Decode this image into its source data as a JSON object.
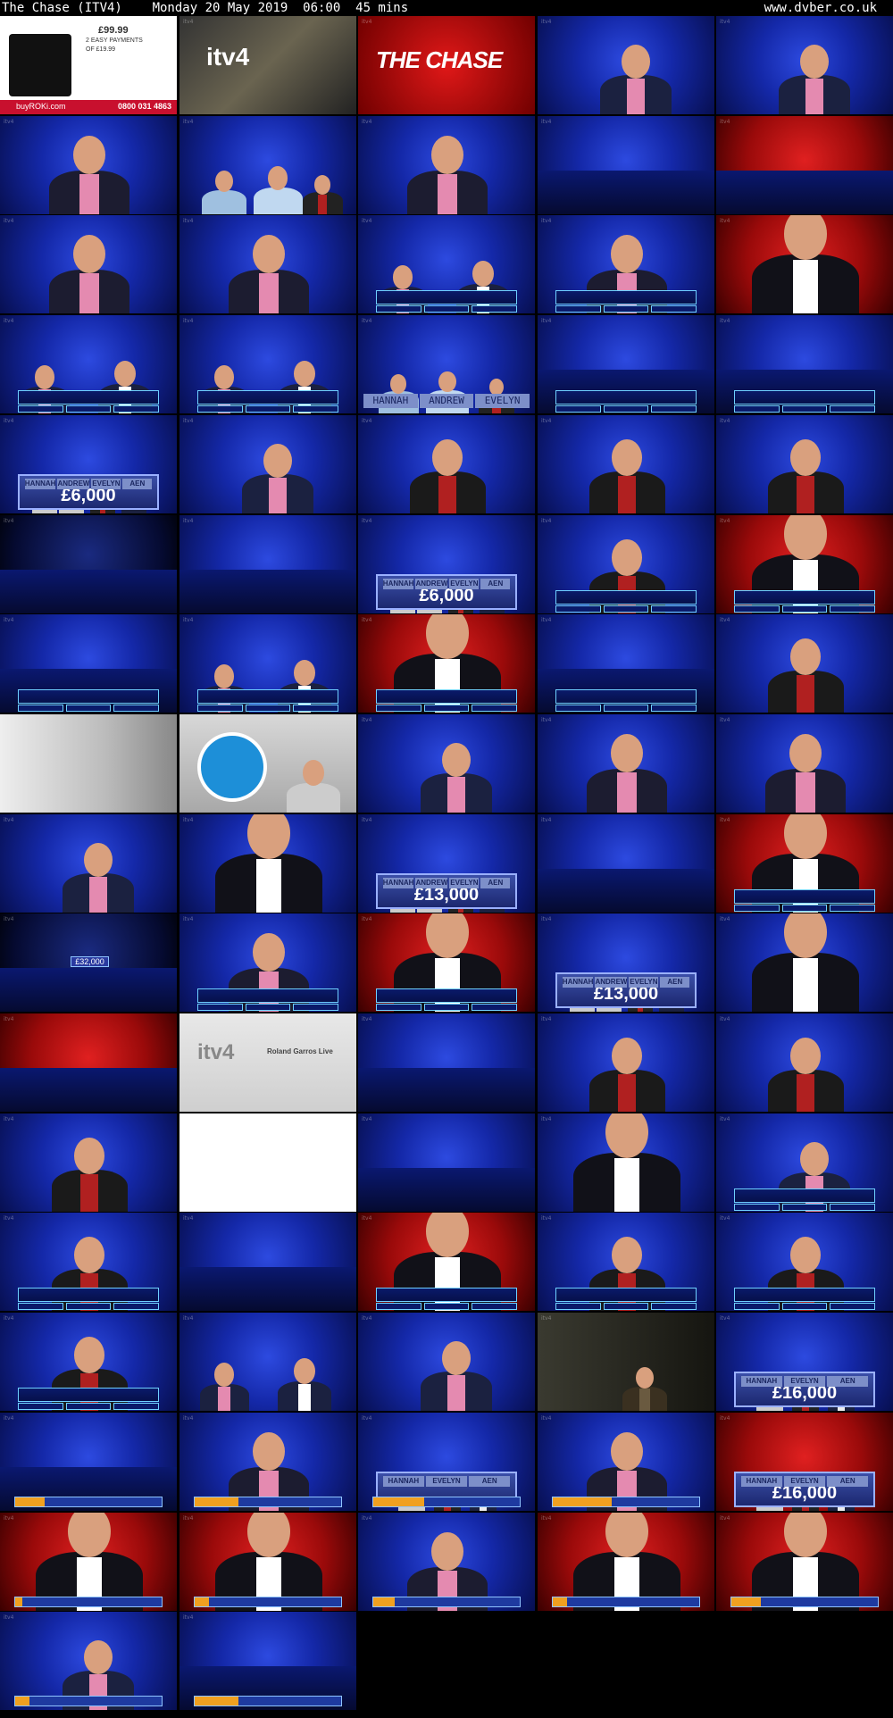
{
  "header": {
    "title": "The Chase (ITV4)    Monday 20 May 2019  06:00  45 mins",
    "site": "www.dvber.co.uk"
  },
  "colors": {
    "studio_blue": "#1a2fb0",
    "studio_red": "#c01010",
    "question_border": "#6fd0ff",
    "background": "#000000"
  },
  "ad": {
    "price": "£99.99",
    "payments": "2 EASY PAYMENTS",
    "payment_amount": "OF £19.99",
    "brand": "buyROKi.com",
    "phone": "0800 031 4863"
  },
  "idents": {
    "channel": "itv4",
    "show": "THE CHASE",
    "promo": "Roland Garros Live"
  },
  "contestants": [
    "HANNAH",
    "ANDREW",
    "EVELYN",
    "AEN"
  ],
  "contestants_late": [
    "HANNAH",
    "EVELYN",
    "AEN"
  ],
  "amounts": {
    "a6000": "£6,000",
    "a13000": "£13,000",
    "a16000": "£16,000",
    "a32000": "£32,000"
  },
  "thumbs": [
    {
      "t": "ad"
    },
    {
      "t": "itv4"
    },
    {
      "t": "chase"
    },
    {
      "t": "host",
      "bg": "blue"
    },
    {
      "t": "host",
      "bg": "blue"
    },
    {
      "t": "person",
      "bg": "blue"
    },
    {
      "t": "trio",
      "bg": "blue"
    },
    {
      "t": "person",
      "bg": "blue"
    },
    {
      "t": "set",
      "bg": "blue"
    },
    {
      "t": "set",
      "bg": "red"
    },
    {
      "t": "person",
      "bg": "blue"
    },
    {
      "t": "person",
      "bg": "blue"
    },
    {
      "t": "duo",
      "bg": "blue",
      "q": true
    },
    {
      "t": "person",
      "bg": "blue",
      "q": true
    },
    {
      "t": "chaser",
      "bg": "red"
    },
    {
      "t": "duo",
      "bg": "blue",
      "q": true
    },
    {
      "t": "duo",
      "bg": "blue",
      "q": true
    },
    {
      "t": "names",
      "bg": "blue"
    },
    {
      "t": "set",
      "bg": "blue",
      "q": true
    },
    {
      "t": "set",
      "bg": "blue",
      "q": true
    },
    {
      "t": "podium",
      "bg": "blue",
      "amt": "a6000"
    },
    {
      "t": "host",
      "bg": "blue"
    },
    {
      "t": "woman",
      "bg": "blue"
    },
    {
      "t": "woman",
      "bg": "blue"
    },
    {
      "t": "woman",
      "bg": "blue"
    },
    {
      "t": "set",
      "bg": "dark"
    },
    {
      "t": "set",
      "bg": "blue"
    },
    {
      "t": "podium",
      "bg": "blue",
      "amt": "a6000"
    },
    {
      "t": "woman",
      "bg": "blue",
      "q": true
    },
    {
      "t": "chaser",
      "bg": "red",
      "q": true
    },
    {
      "t": "set",
      "bg": "blue",
      "q": true
    },
    {
      "t": "duo",
      "bg": "blue",
      "q": true
    },
    {
      "t": "chaser",
      "bg": "red",
      "q": true
    },
    {
      "t": "set",
      "bg": "blue",
      "q": true
    },
    {
      "t": "woman",
      "bg": "blue"
    },
    {
      "t": "wall",
      "bg": "grey"
    },
    {
      "t": "trustatrader",
      "bg": "grey"
    },
    {
      "t": "host",
      "bg": "blue"
    },
    {
      "t": "person",
      "bg": "blue"
    },
    {
      "t": "person",
      "bg": "blue"
    },
    {
      "t": "host",
      "bg": "blue"
    },
    {
      "t": "chaser",
      "bg": "blue"
    },
    {
      "t": "podium",
      "bg": "blue",
      "amt": "a13000"
    },
    {
      "t": "set",
      "bg": "blue"
    },
    {
      "t": "chaser",
      "bg": "red",
      "q": true
    },
    {
      "t": "set",
      "bg": "dark",
      "amt": "a32000"
    },
    {
      "t": "person",
      "bg": "blue",
      "q": true
    },
    {
      "t": "chaser",
      "bg": "red",
      "q": true
    },
    {
      "t": "podium",
      "bg": "blue",
      "amt": "a13000"
    },
    {
      "t": "chaser",
      "bg": "blue"
    },
    {
      "t": "set",
      "bg": "red"
    },
    {
      "t": "promo",
      "bg": "white"
    },
    {
      "t": "set",
      "bg": "blue"
    },
    {
      "t": "woman",
      "bg": "blue"
    },
    {
      "t": "woman",
      "bg": "blue"
    },
    {
      "t": "woman",
      "bg": "blue"
    },
    {
      "t": "blank",
      "bg": "white"
    },
    {
      "t": "set",
      "bg": "blue"
    },
    {
      "t": "chaser",
      "bg": "blue"
    },
    {
      "t": "host",
      "bg": "blue",
      "q": true
    },
    {
      "t": "woman",
      "bg": "blue",
      "q": true
    },
    {
      "t": "set",
      "bg": "blue"
    },
    {
      "t": "chaser",
      "bg": "red",
      "q": true
    },
    {
      "t": "woman",
      "bg": "blue",
      "q": true
    },
    {
      "t": "woman",
      "bg": "blue",
      "q": true
    },
    {
      "t": "woman",
      "bg": "blue",
      "q": true
    },
    {
      "t": "duo",
      "bg": "blue"
    },
    {
      "t": "host",
      "bg": "blue"
    },
    {
      "t": "drama",
      "bg": "dark"
    },
    {
      "t": "podium3",
      "bg": "blue",
      "amt": "a16000"
    },
    {
      "t": "set",
      "bg": "blue",
      "sb": 0.2
    },
    {
      "t": "person",
      "bg": "blue",
      "sb": 0.3
    },
    {
      "t": "podium3",
      "bg": "blue",
      "sb": 0.35
    },
    {
      "t": "person",
      "bg": "blue",
      "sb": 0.4
    },
    {
      "t": "podium3",
      "bg": "red",
      "amt": "a16000"
    },
    {
      "t": "chaser",
      "bg": "red",
      "sb": 0.05
    },
    {
      "t": "chaser",
      "bg": "red",
      "sb": 0.1
    },
    {
      "t": "person",
      "bg": "blue",
      "sb": 0.15
    },
    {
      "t": "chaser",
      "bg": "red",
      "sb": 0.1
    },
    {
      "t": "chaser",
      "bg": "red",
      "sb": 0.2
    },
    {
      "t": "host",
      "bg": "blue",
      "sb": 0.1
    },
    {
      "t": "set",
      "bg": "blue",
      "sb": 0.3
    }
  ]
}
